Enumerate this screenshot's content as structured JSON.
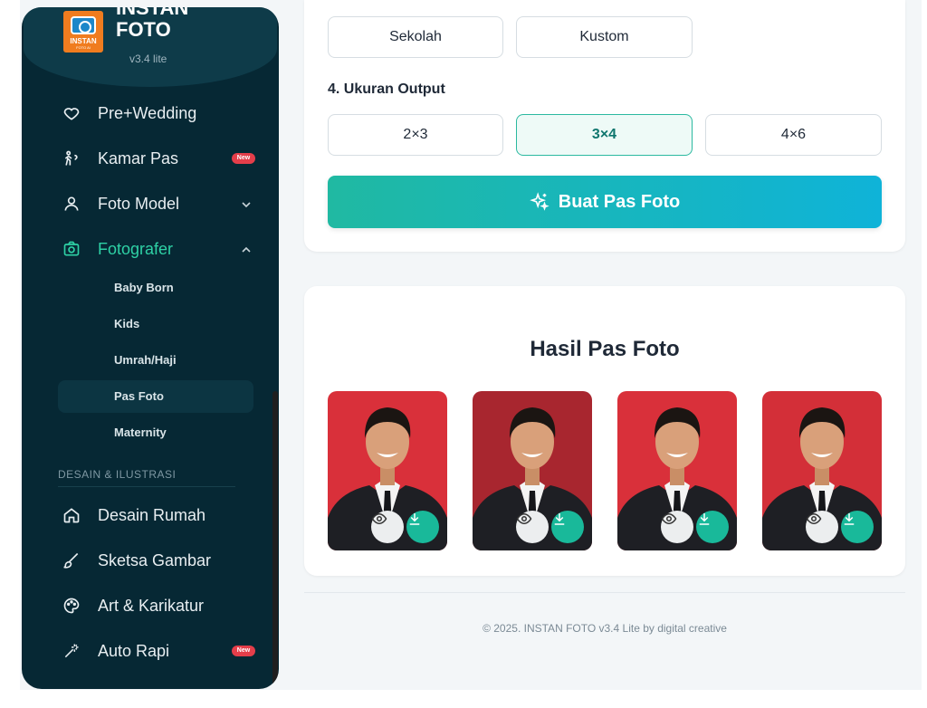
{
  "brand": {
    "logo_text": "INSTAN",
    "logo_sub": "FOTO AI",
    "title_line1": "INSTAN",
    "title_line2": "FOTO",
    "version": "v3.4 lite"
  },
  "sidebar": {
    "items": [
      {
        "label": "Pre+Wedding",
        "icon": "heart-icon"
      },
      {
        "label": "Kamar Pas",
        "icon": "person-hanger-icon",
        "badge": "New"
      },
      {
        "label": "Foto Model",
        "icon": "user-icon",
        "chevron": "down"
      },
      {
        "label": "Fotografer",
        "icon": "camera-icon",
        "chevron": "up",
        "active": true
      }
    ],
    "sub_items": [
      "Baby Born",
      "Kids",
      "Umrah/Haji",
      "Pas Foto",
      "Maternity"
    ],
    "active_sub": "Pas Foto",
    "section_label": "DESAIN & ILUSTRASI",
    "section_items": [
      {
        "label": "Desain Rumah",
        "icon": "house-icon"
      },
      {
        "label": "Sketsa Gambar",
        "icon": "brush-icon"
      },
      {
        "label": "Art & Karikatur",
        "icon": "palette-icon"
      },
      {
        "label": "Auto Rapi",
        "icon": "magic-wand-icon",
        "badge": "New"
      }
    ]
  },
  "form": {
    "style_options": [
      "Sekolah",
      "Kustom"
    ],
    "size_heading": "4. Ukuran Output",
    "size_options": [
      "2×3",
      "3×4",
      "4×6"
    ],
    "selected_size": "3×4",
    "generate_label": "Buat Pas Foto"
  },
  "results": {
    "title": "Hasil Pas Foto",
    "photos": [
      {
        "bg": "#d9303a"
      },
      {
        "bg": "#a8262f"
      },
      {
        "bg": "#d9303a"
      },
      {
        "bg": "#d32f38"
      }
    ]
  },
  "footer": {
    "text": "© 2025. INSTAN FOTO v3.4 Lite by digital creative"
  },
  "colors": {
    "sidebar_bg": "#062834",
    "accent": "#2ed1a5",
    "cta_start": "#20b9a2",
    "cta_end": "#0fb3d8",
    "badge_new": "#e43e4a"
  }
}
